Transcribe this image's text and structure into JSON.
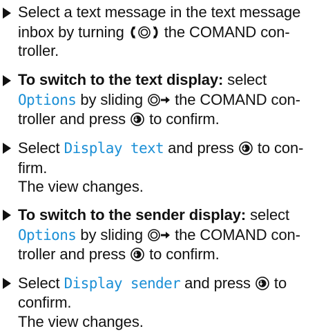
{
  "steps": [
    {
      "lines": [
        {
          "t1": "Select a text message in the text message"
        },
        {
          "t1": "inbox by turning ",
          "t2": " the COMAND con-"
        },
        {
          "t1": "troller."
        }
      ]
    },
    {
      "bold": "To switch to the text display:",
      "select": " select",
      "mono": "Options",
      "l2b": " by sliding ",
      "l2c": " the COMAND con-",
      "l3a": "troller and press ",
      "l3b": " to confirm."
    },
    {
      "l1a": "Select ",
      "mono": "Display text",
      "l1b": " and press ",
      "l1c": " to con-",
      "l2": "firm.",
      "l3": "The view changes."
    },
    {
      "bold": "To switch to the sender display:",
      "select": " select",
      "mono": "Options",
      "l2b": " by sliding ",
      "l2c": " the COMAND con-",
      "l3a": "troller and press ",
      "l3b": " to confirm."
    },
    {
      "l1a": "Select ",
      "mono": "Display sender",
      "l1b": " and press ",
      "l1c": " to",
      "l2": "confirm.",
      "l3": "The view changes."
    }
  ],
  "icons": {
    "turn": "controller-turn-icon",
    "slide": "controller-slide-right-icon",
    "press": "controller-press-icon"
  },
  "colors": {
    "text": "#111111",
    "menu_item": "#1a8fd6"
  }
}
